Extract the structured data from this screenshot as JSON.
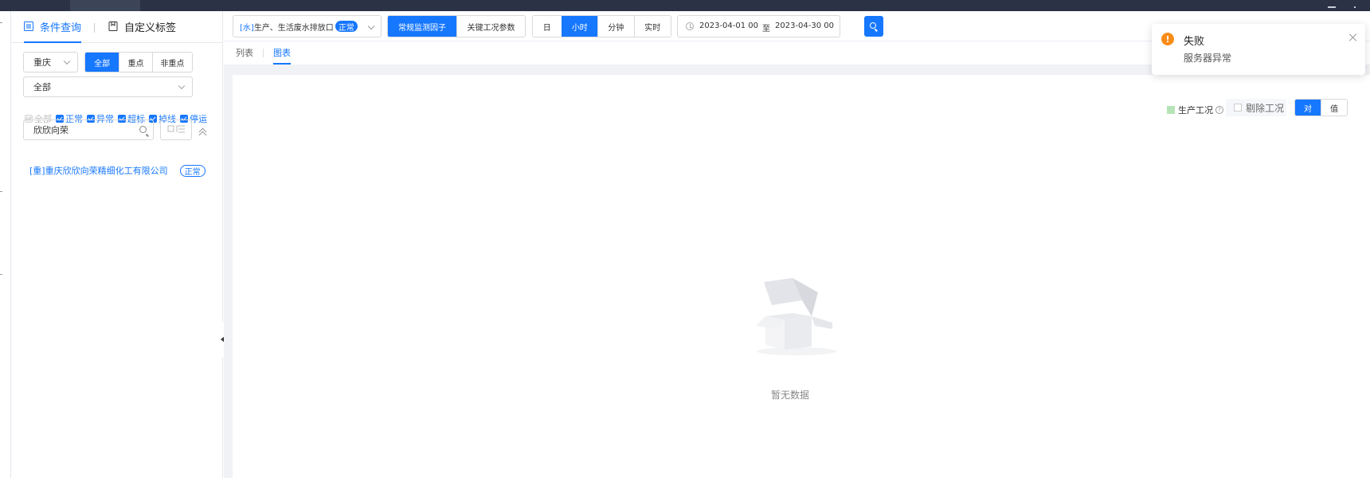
{
  "sidebar": {
    "tabs": [
      {
        "label": "条件查询",
        "icon": "filter-list-icon"
      },
      {
        "label": "自定义标签",
        "icon": "bookmark-icon"
      }
    ],
    "region": {
      "value": "重庆"
    },
    "scope_filter": {
      "options": [
        "全部",
        "重点",
        "非重点"
      ],
      "selected": "全部"
    },
    "industry": {
      "value": "全部"
    },
    "status_checks": [
      {
        "label": "全部",
        "checked": true,
        "disabled": true
      },
      {
        "label": "正常",
        "checked": true
      },
      {
        "label": "异常",
        "checked": true
      },
      {
        "label": "超标",
        "checked": true
      },
      {
        "label": "掉线",
        "checked": true
      },
      {
        "label": "停运",
        "checked": true
      }
    ],
    "search": {
      "value": "欣欣向荣"
    },
    "results": [
      {
        "name": "[重]重庆欣欣向荣精细化工有限公司",
        "status": "正常"
      }
    ]
  },
  "toolbar": {
    "outlet": {
      "type": "[水]",
      "name": "生产、生活废水排放口",
      "status": "正常"
    },
    "factor_tabs": {
      "options": [
        "常规监测因子",
        "关键工况参数"
      ],
      "selected": "常规监测因子"
    },
    "granularity": {
      "options": [
        "日",
        "小时",
        "分钟",
        "实时"
      ],
      "selected": "小时"
    },
    "date_range": {
      "start": "2023-04-01 00",
      "separator": "至",
      "end": "2023-04-30 00"
    }
  },
  "view_tabs": {
    "options": [
      "列表",
      "图表"
    ],
    "selected": "图表"
  },
  "chart_panel": {
    "legend": {
      "label": "生产工况",
      "color": "#b7e4b7",
      "help": "?"
    },
    "remove_condition": {
      "label": "剔除工况",
      "checked": false
    },
    "value_mode": {
      "options": [
        "对",
        "值"
      ],
      "selected": "对"
    },
    "empty_text": "暂无数据"
  },
  "notification": {
    "type": "warning",
    "title": "失败",
    "message": "服务器异常",
    "accent": "#fa8c16"
  },
  "colors": {
    "primary": "#1677ff",
    "topbar": "#2b3245"
  }
}
